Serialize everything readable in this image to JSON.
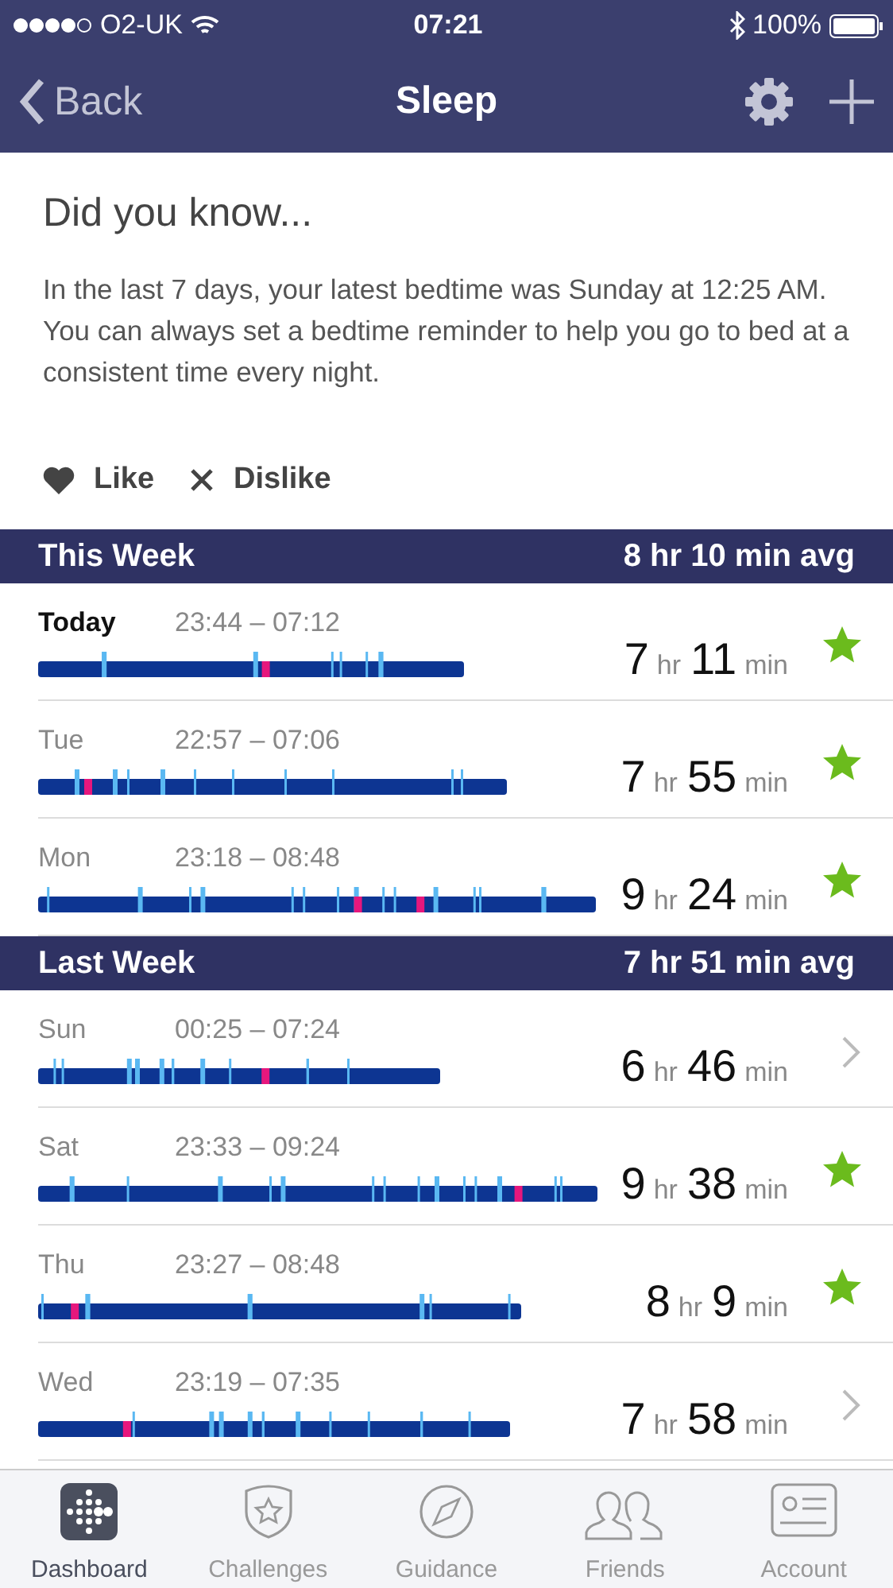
{
  "status_bar": {
    "carrier": "O2-UK",
    "time": "07:21",
    "battery": "100%"
  },
  "nav": {
    "back": "Back",
    "title": "Sleep"
  },
  "tip": {
    "title": "Did you know...",
    "text": "In the last 7 days, your latest bedtime was Sunday at 12:25 AM. You can always set a bedtime reminder to help you go to bed at a consistent time every night.",
    "like": "Like",
    "dislike": "Dislike"
  },
  "sections": [
    {
      "title": "This Week",
      "average": "8 hr 10 min avg",
      "rows": [
        {
          "day": "Today",
          "current": true,
          "times": "23:44 – 07:12",
          "hours": "7",
          "hours_unit": "hr",
          "minutes": "11",
          "minutes_unit": "min",
          "goal_met": true
        },
        {
          "day": "Tue",
          "current": false,
          "times": "22:57 – 07:06",
          "hours": "7",
          "hours_unit": "hr",
          "minutes": "55",
          "minutes_unit": "min",
          "goal_met": true
        },
        {
          "day": "Mon",
          "current": false,
          "times": "23:18 – 08:48",
          "hours": "9",
          "hours_unit": "hr",
          "minutes": "24",
          "minutes_unit": "min",
          "goal_met": true
        }
      ]
    },
    {
      "title": "Last Week",
      "average": "7 hr 51 min avg",
      "rows": [
        {
          "day": "Sun",
          "current": false,
          "times": "00:25 – 07:24",
          "hours": "6",
          "hours_unit": "hr",
          "minutes": "46",
          "minutes_unit": "min",
          "goal_met": false
        },
        {
          "day": "Sat",
          "current": false,
          "times": "23:33 – 09:24",
          "hours": "9",
          "hours_unit": "hr",
          "minutes": "38",
          "minutes_unit": "min",
          "goal_met": true
        },
        {
          "day": "Thu",
          "current": false,
          "times": "23:27 – 08:48",
          "hours": "8",
          "hours_unit": "hr",
          "minutes": "9",
          "minutes_unit": "min",
          "goal_met": true
        },
        {
          "day": "Wed",
          "current": false,
          "times": "23:19 – 07:35",
          "hours": "7",
          "hours_unit": "hr",
          "minutes": "58",
          "minutes_unit": "min",
          "goal_met": false
        }
      ]
    }
  ],
  "tab_bar": [
    {
      "kind": "dashboard",
      "label": "Dashboard",
      "selected": true
    },
    {
      "kind": "challenges",
      "label": "Challenges",
      "selected": false
    },
    {
      "kind": "guidance",
      "label": "Guidance",
      "selected": false
    },
    {
      "kind": "friends",
      "label": "Friends",
      "selected": false
    },
    {
      "kind": "account",
      "label": "Account",
      "selected": false
    }
  ]
}
